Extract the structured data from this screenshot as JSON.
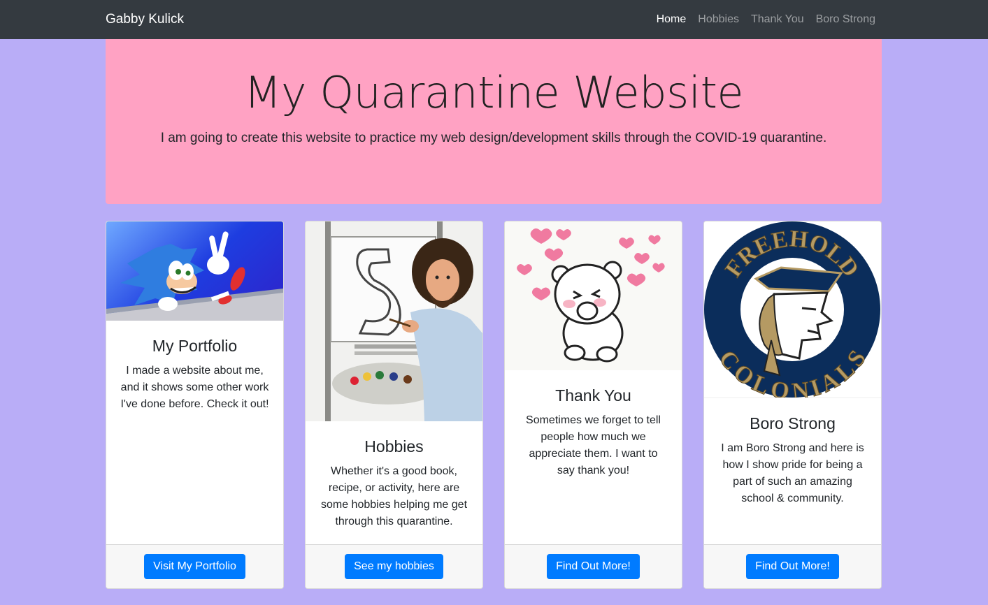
{
  "nav": {
    "brand": "Gabby Kulick",
    "links": [
      "Home",
      "Hobbies",
      "Thank You",
      "Boro Strong"
    ]
  },
  "jumbotron": {
    "title": "My Quarantine Website",
    "lead": "I am going to create this website to practice my web design/development skills through the COVID-19 quarantine."
  },
  "cards": [
    {
      "image": "sonic-hedgehog-illustration",
      "title": "My Portfolio",
      "text": "I made a website about me, and it shows some other work I've done before. Check it out!",
      "button": "Visit My Portfolio"
    },
    {
      "image": "bob-ross-painting-photo",
      "title": "Hobbies",
      "text": "Whether it's a good book, recipe, or activity, here are some hobbies helping me get through this quarantine.",
      "button": "See my hobbies"
    },
    {
      "image": "cute-bear-hearts-illustration",
      "title": "Thank You",
      "text": "Sometimes we forget to tell people how much we appreciate them. I want to say thank you!",
      "button": "Find Out More!"
    },
    {
      "image": "freehold-colonials-logo",
      "logo_text_top": "FREEHOLD",
      "logo_text_bottom": "COLONIALS",
      "title": "Boro Strong",
      "text": "I am Boro Strong and here is how I show pride for being a part of such an amazing school & community.",
      "button": "Find Out More!"
    }
  ],
  "colors": {
    "navbar": "#343a40",
    "page_background": "#b9adf7",
    "jumbotron": "#ffa2c3",
    "button": "#007bff"
  }
}
